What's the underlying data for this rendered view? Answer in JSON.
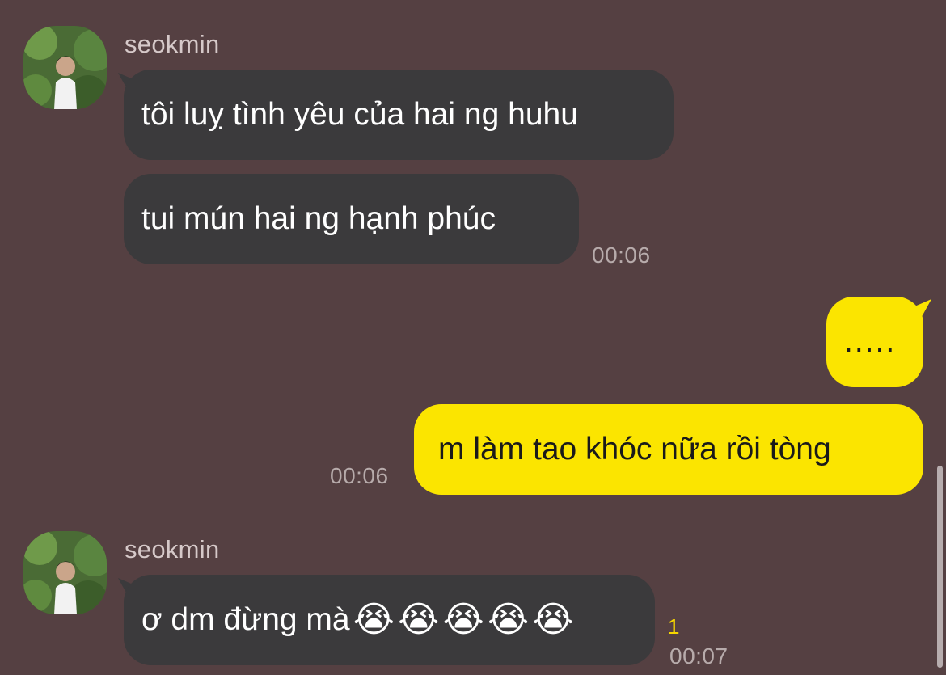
{
  "messages": [
    {
      "sender": "seokmin",
      "lines": [
        "tôi luỵ tình yêu của hai ng huhu",
        "tui mún hai ng hạnh phúc"
      ],
      "time": "00:06"
    },
    {
      "outgoing": true,
      "lines": [
        ".....",
        "m làm tao khóc nữa rồi tòng"
      ],
      "time": "00:06"
    },
    {
      "sender": "seokmin",
      "text": "ơ dm đừng mà",
      "emoji": [
        "😭",
        "😭",
        "😭",
        "😭",
        "😭"
      ],
      "unread": "1",
      "time": "00:07"
    }
  ],
  "colors": {
    "background": "#554042",
    "incoming_bubble": "#3b3a3c",
    "outgoing_bubble": "#fbe500",
    "unread": "#f6d600"
  },
  "icons": {
    "avatar": "profile-photo",
    "emoji": "loudly-crying-face"
  }
}
